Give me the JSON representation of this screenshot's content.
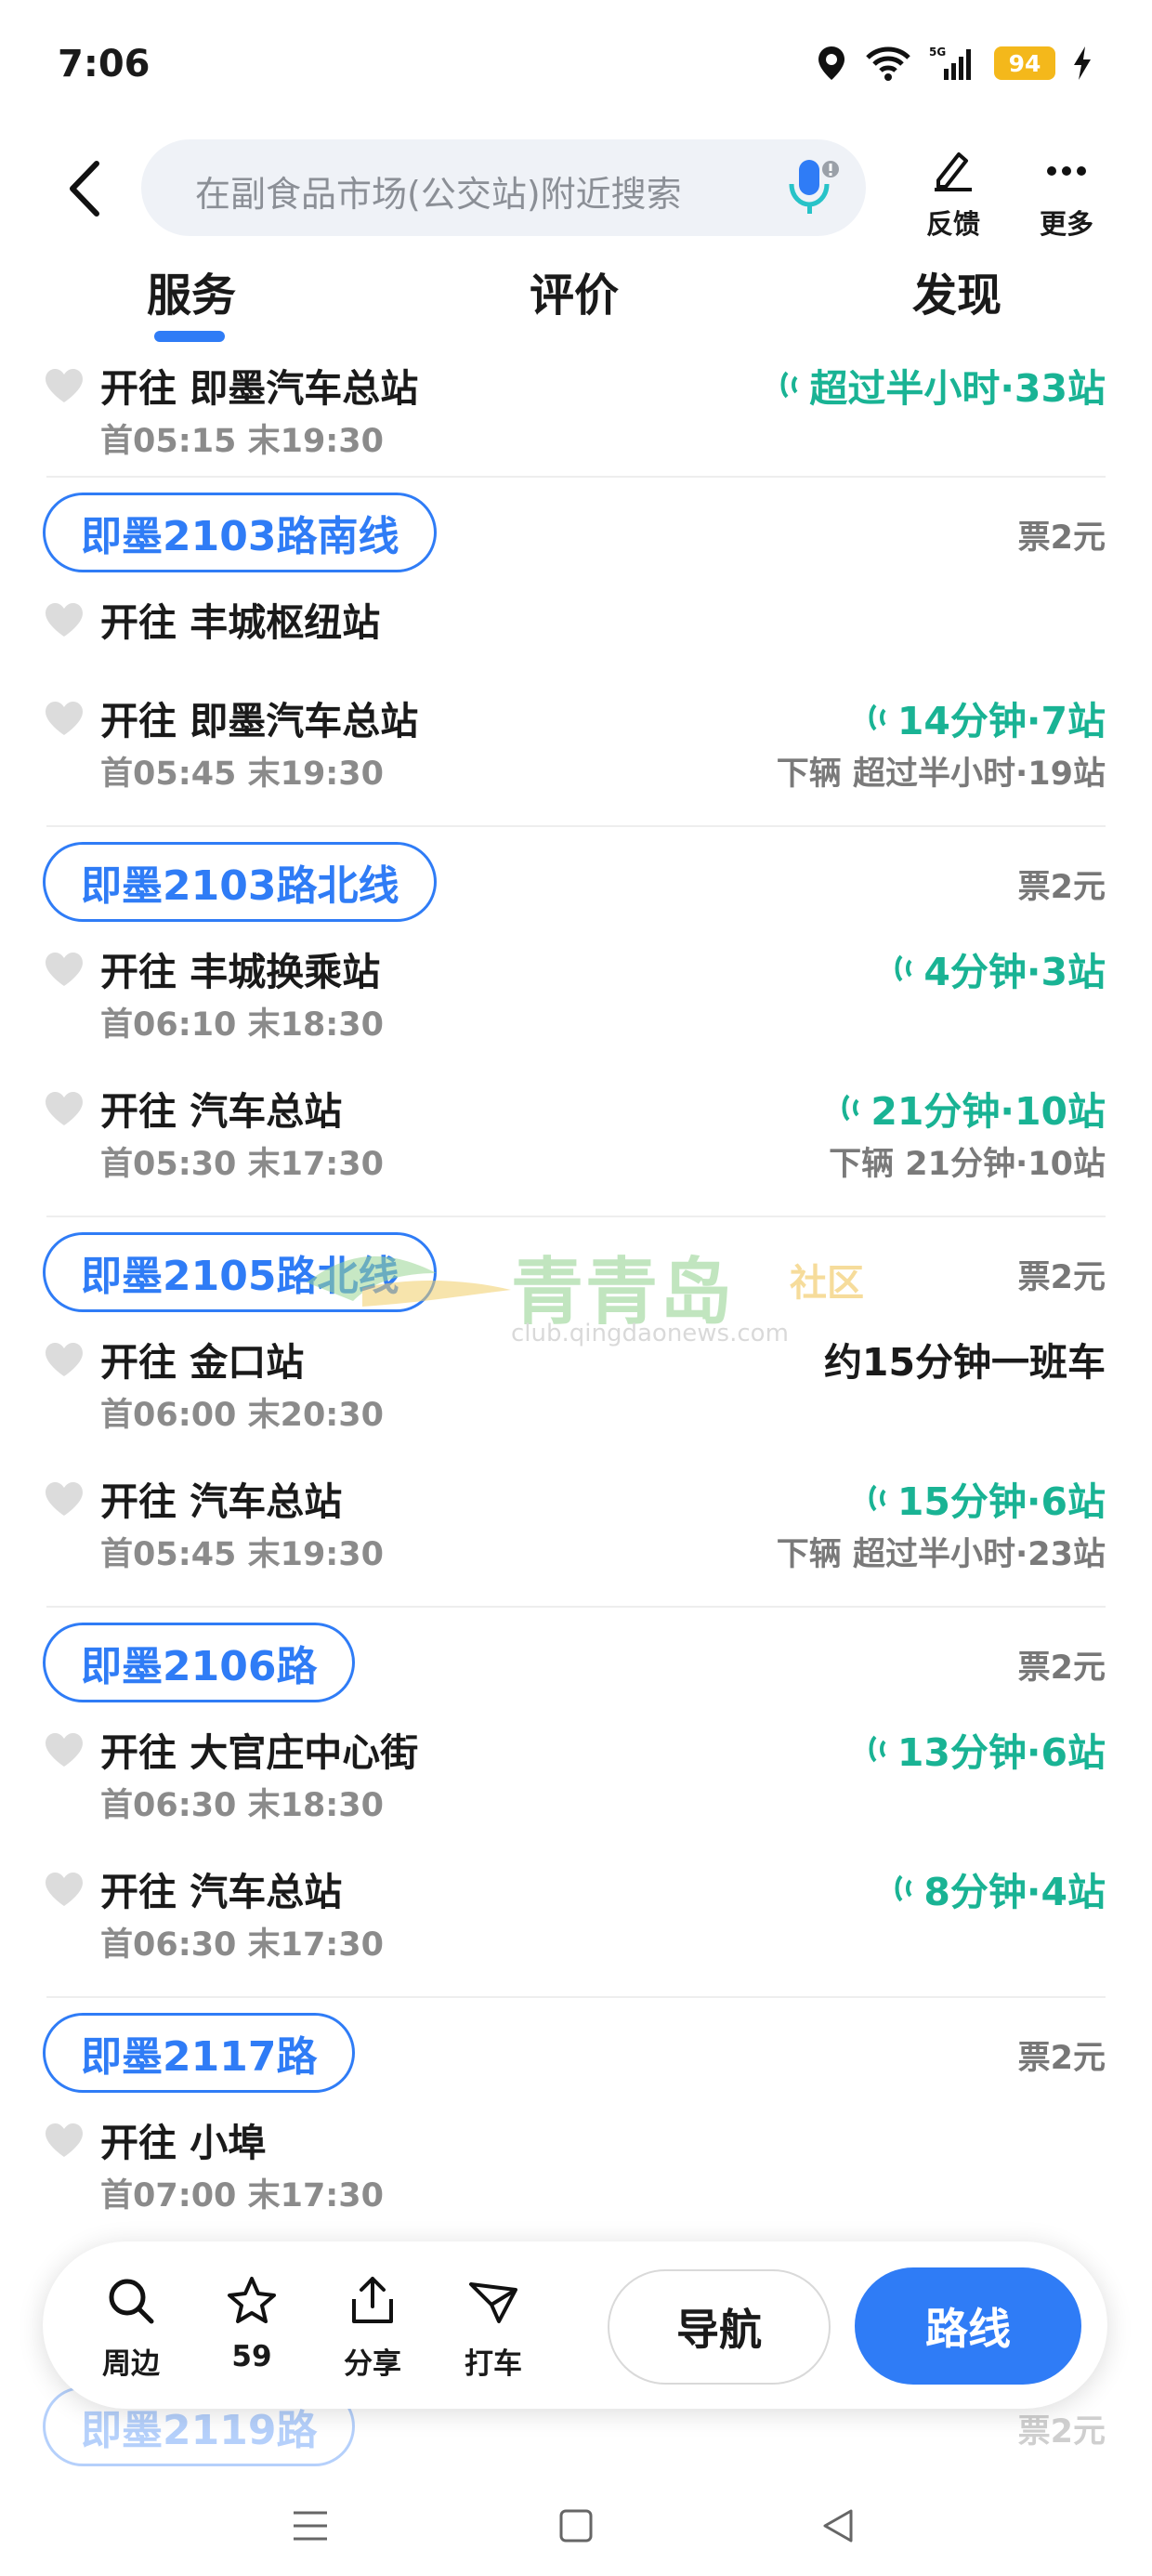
{
  "status_bar": {
    "time": "7:06",
    "network": "5G",
    "battery": "94"
  },
  "header": {
    "search_placeholder": "在副食品市场(公交站)附近搜索",
    "feedback_label": "反馈",
    "more_label": "更多"
  },
  "tabs": [
    {
      "label": "服务",
      "active": true
    },
    {
      "label": "评价",
      "active": false
    },
    {
      "label": "发现",
      "active": false
    }
  ],
  "routes": [
    {
      "name": "",
      "fare": "",
      "directions": [
        {
          "title": "开往 即墨汽车总站",
          "times": "首05:15 末19:30",
          "realtime": "超过半小时·33站",
          "next": ""
        }
      ]
    },
    {
      "name": "即墨2103路南线",
      "fare": "票2元",
      "directions": [
        {
          "title": "开往 丰城枢纽站",
          "times": "",
          "realtime": "",
          "next": ""
        },
        {
          "title": "开往 即墨汽车总站",
          "times": "首05:45 末19:30",
          "realtime": "14分钟·7站",
          "next": "下辆 超过半小时·19站"
        }
      ]
    },
    {
      "name": "即墨2103路北线",
      "fare": "票2元",
      "directions": [
        {
          "title": "开往 丰城换乘站",
          "times": "首06:10 末18:30",
          "realtime": "4分钟·3站",
          "next": ""
        },
        {
          "title": "开往 汽车总站",
          "times": "首05:30 末17:30",
          "realtime": "21分钟·10站",
          "next": "下辆 21分钟·10站"
        }
      ]
    },
    {
      "name": "即墨2105路北线",
      "fare": "票2元",
      "directions": [
        {
          "title": "开往 金口站",
          "times": "首06:00 末20:30",
          "frequency": "约15分钟一班车",
          "next": ""
        },
        {
          "title": "开往 汽车总站",
          "times": "首05:45 末19:30",
          "realtime": "15分钟·6站",
          "next": "下辆 超过半小时·23站"
        }
      ]
    },
    {
      "name": "即墨2106路",
      "fare": "票2元",
      "directions": [
        {
          "title": "开往 大官庄中心街",
          "times": "首06:30 末18:30",
          "realtime": "13分钟·6站",
          "next": ""
        },
        {
          "title": "开往 汽车总站",
          "times": "首06:30 末17:30",
          "realtime": "8分钟·4站",
          "next": ""
        }
      ]
    },
    {
      "name": "即墨2117路",
      "fare": "票2元",
      "directions": [
        {
          "title": "开往 小埠",
          "times": "首07:00 末17:30",
          "realtime": "",
          "next": ""
        }
      ]
    },
    {
      "name": "即墨2119路",
      "fare": "票2元",
      "directions": []
    }
  ],
  "watermark": {
    "text": "青青岛",
    "sub": "社区",
    "url": "club.qingdaonews.com"
  },
  "bottom_bar": {
    "nearby_label": "周边",
    "favorites_count": "59",
    "share_label": "分享",
    "taxi_label": "打车",
    "navigate_label": "导航",
    "route_label": "路线"
  },
  "colors": {
    "accent": "#2f7cf6",
    "realtime": "#19b394",
    "battery": "#f4b81b"
  }
}
